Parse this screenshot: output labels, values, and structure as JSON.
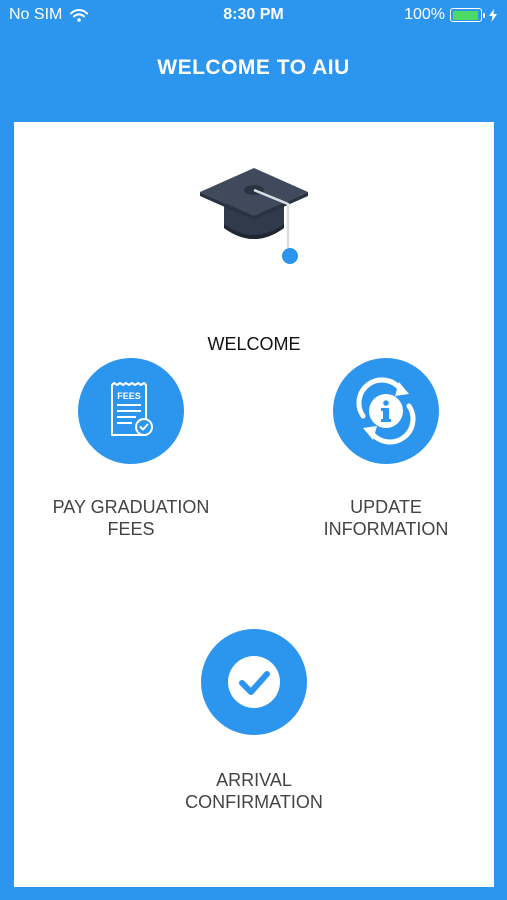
{
  "status_bar": {
    "carrier": "No SIM",
    "time": "8:30 PM",
    "battery": "100%",
    "battery_level": 1.0
  },
  "header": {
    "title": "WELCOME TO AIU"
  },
  "hero": {
    "icon": "graduation-cap-icon",
    "label": "WELCOME"
  },
  "actions": [
    {
      "icon": "fees-receipt-icon",
      "line1": "PAY GRADUATION",
      "line2": "FEES"
    },
    {
      "icon": "update-info-icon",
      "line1": "UPDATE",
      "line2": "INFORMATION"
    },
    {
      "icon": "checkmark-icon",
      "line1": "ARRIVAL",
      "line2": "CONFIRMATION"
    }
  ],
  "icon_text": {
    "fees": "FEES"
  },
  "colors": {
    "primary": "#2c96ef",
    "card": "#ffffff",
    "cap_dark": "#2f3a4a",
    "battery_green": "#4cd964"
  }
}
